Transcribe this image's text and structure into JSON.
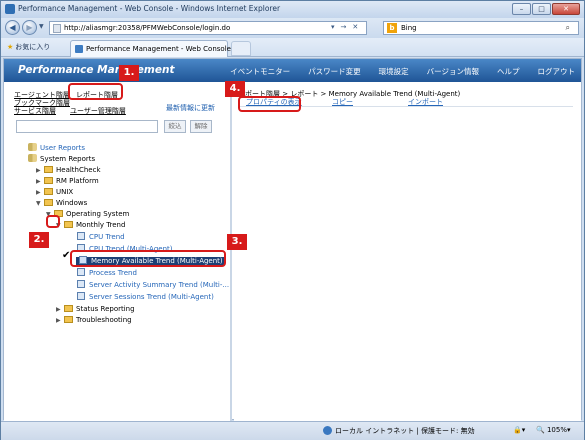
{
  "browser": {
    "title": "Performance Management - Web Console - Windows Internet Explorer",
    "url": "http://aliasmgr:20358/PFMWebConsole/login.do",
    "search_label": "Bing",
    "favorites_label": "お気に入り",
    "tab_label": "Performance Management - Web Console",
    "window_buttons": [
      "–",
      "□",
      "✕"
    ],
    "nav_tool_labels": [
      "▾",
      "→",
      "✕"
    ]
  },
  "app": {
    "title": "Performance Management",
    "topnav": [
      "イベントモニター",
      "パスワード変更",
      "環境設定",
      "バージョン情報",
      "ヘルプ",
      "ログアウト"
    ]
  },
  "leftnav": {
    "agent": "エージェント階層",
    "report": "レポート階層",
    "bookmark": "ブックマーク階層",
    "service": "サービス階層",
    "user": "ユーザー管理階層",
    "refresh": "最新情報に更新",
    "filter_narrow": "絞込",
    "filter_clear": "解除"
  },
  "tree": {
    "user_reports": "User Reports",
    "system_reports": "System Reports",
    "healthcheck": "HealthCheck",
    "rm_platform": "RM Platform",
    "unix": "UNIX",
    "windows": "Windows",
    "operating_system": "Operating System",
    "monthly_trend": "Monthly Trend",
    "cpu_trend": "CPU Trend",
    "cpu_trend_multi": "CPU Trend (Multi-Agent)",
    "memory_available": "Memory Available Trend (Multi-Agent)",
    "process_trend": "Process Trend",
    "server_activity": "Server Activity Summary Trend (Multi-...",
    "server_sessions": "Server Sessions Trend (Multi-Agent)",
    "status_reporting": "Status Reporting",
    "troubleshooting": "Troubleshooting"
  },
  "rightpane": {
    "breadcrumb": "レポート階層 > レポート > Memory Available Trend (Multi-Agent)",
    "properties": "プロパティの表示",
    "copy": "コピー",
    "import": "インポート"
  },
  "status": {
    "zone": "ローカル イントラネット | 保護モード: 無効",
    "zoom": "105%"
  },
  "callouts": [
    "1.",
    "2.",
    "3.",
    "4."
  ],
  "colors": {
    "callout": "#d71a1a",
    "header": "#1f5596",
    "link": "#2566b8",
    "selected": "#1d3f74"
  }
}
